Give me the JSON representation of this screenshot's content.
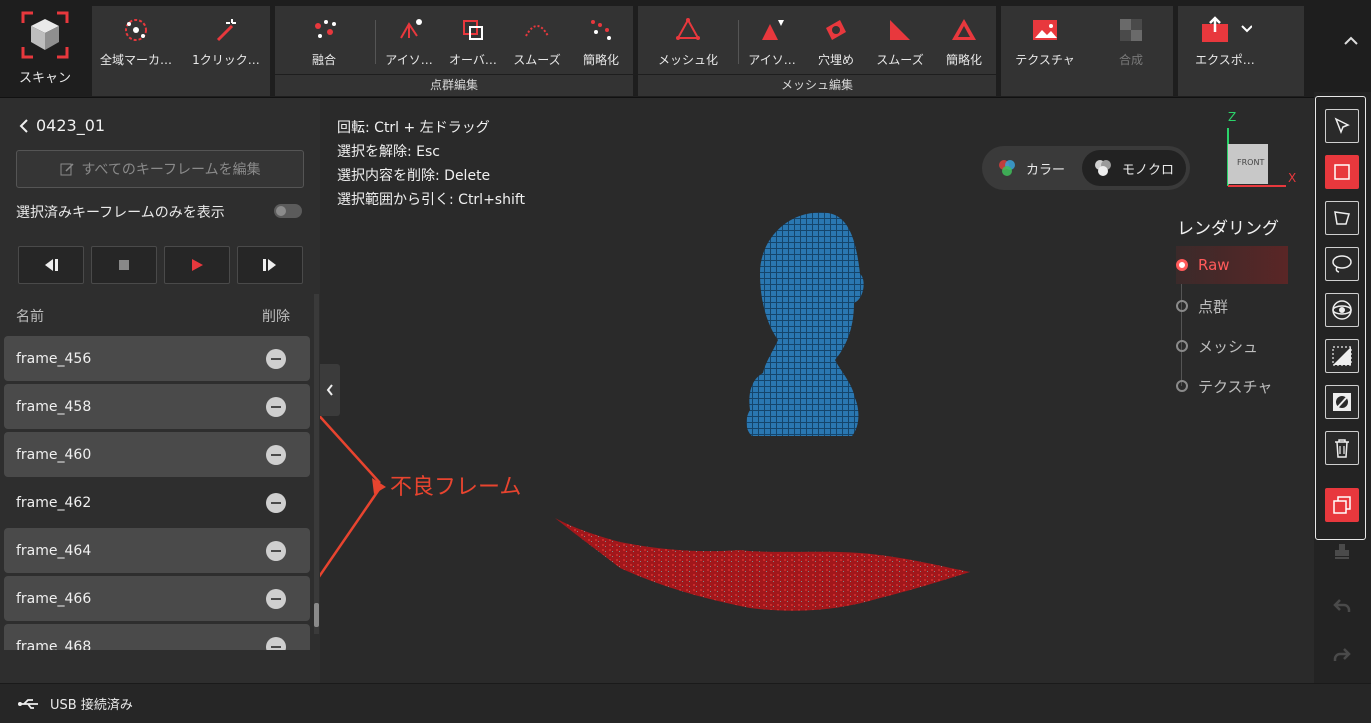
{
  "toolbar": {
    "scan": "スキャン",
    "global_marker": "全域マーカ…",
    "one_click": "1クリック…",
    "fusion": "融合",
    "pc_isolated": "アイソ…",
    "pc_overlap": "オーバ…",
    "pc_smooth": "スムーズ",
    "pc_simplify": "簡略化",
    "pc_group": "点群編集",
    "meshing": "メッシュ化",
    "mesh_isolated": "アイソ…",
    "hole_fill": "穴埋め",
    "mesh_smooth": "スムーズ",
    "mesh_simplify": "簡略化",
    "mesh_group": "メッシュ編集",
    "texture": "テクスチャ",
    "merge": "合成",
    "export": "エクスポ…"
  },
  "left": {
    "project": "0423_01",
    "edit_all": "すべてのキーフレームを編集",
    "only_selected": "選択済みキーフレームのみを表示",
    "col_name": "名前",
    "col_delete": "削除",
    "frames": [
      {
        "name": "frame_456",
        "highlight": true
      },
      {
        "name": "frame_458",
        "highlight": true
      },
      {
        "name": "frame_460",
        "highlight": true
      },
      {
        "name": "frame_462",
        "highlight": false
      },
      {
        "name": "frame_464",
        "highlight": true
      },
      {
        "name": "frame_466",
        "highlight": true
      },
      {
        "name": "frame_468",
        "highlight": true
      }
    ]
  },
  "viewport": {
    "help": [
      "回転: Ctrl + 左ドラッグ",
      "選択を解除: Esc",
      "選択内容を削除: Delete",
      "選択範囲から引く: Ctrl+shift"
    ],
    "color_mode": {
      "color": "カラー",
      "mono": "モノクロ"
    },
    "rendering_title": "レンダリング",
    "rendering_options": [
      "Raw",
      "点群",
      "メッシュ",
      "テクスチャ"
    ],
    "rendering_selected": "Raw",
    "axis": {
      "z": "Z",
      "x": "X",
      "front": "FRONT"
    },
    "annotation": "不良フレーム"
  },
  "status": {
    "usb": "USB 接続済み"
  },
  "colors": {
    "accent": "#e8383d",
    "model": "#2a7bb8",
    "noise": "#b5191c"
  }
}
